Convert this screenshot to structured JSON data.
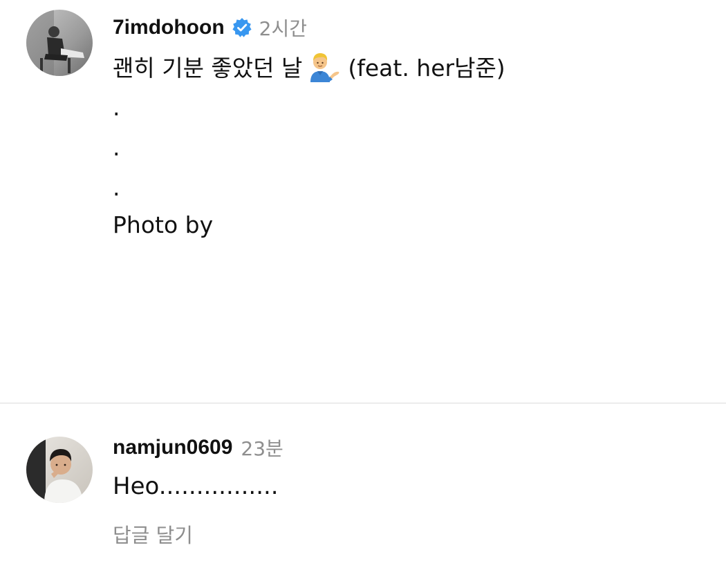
{
  "post": {
    "username": "7imdohoon",
    "verified": true,
    "time": "2시간",
    "caption_text": "괜히 기분 좋았던 날",
    "caption_emoji": "man-tipping-hand-emoji",
    "caption_feat": "(feat. her남준)",
    "caption_dots": [
      ".",
      ".",
      "."
    ],
    "caption_photo_by": "Photo by"
  },
  "comment": {
    "username": "namjun0609",
    "time": "23분",
    "text": "Heo................",
    "reply_label": "답글 달기"
  },
  "colors": {
    "verified_badge": "#3897f0",
    "secondary_text": "#8e8e8e",
    "divider": "#dbdbdb"
  }
}
